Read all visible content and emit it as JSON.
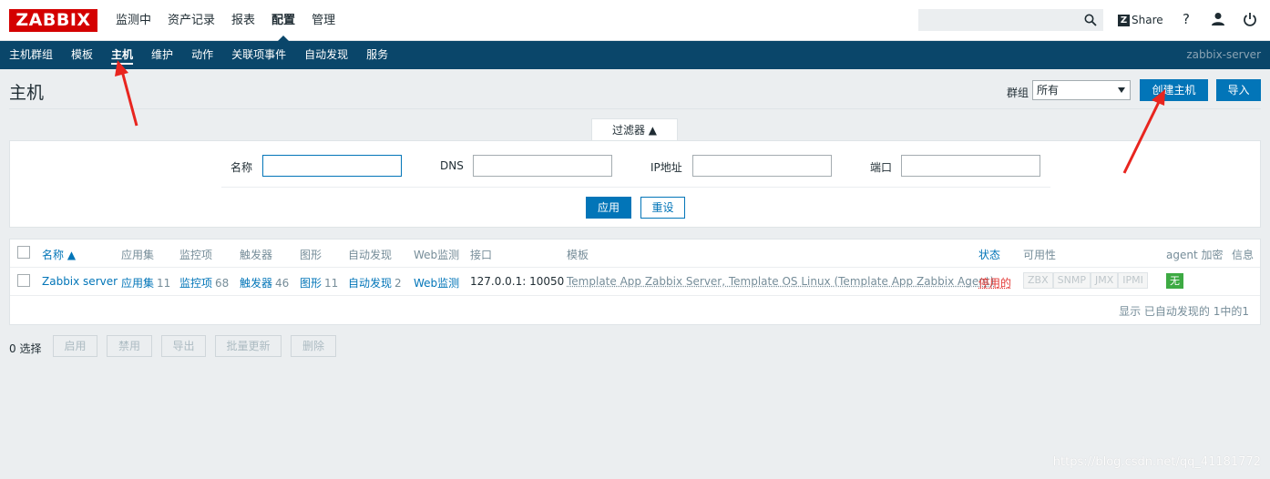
{
  "logo": "ZABBIX",
  "main_nav": [
    {
      "label": "监测中",
      "active": false
    },
    {
      "label": "资产记录",
      "active": false
    },
    {
      "label": "报表",
      "active": false
    },
    {
      "label": "配置",
      "active": true
    },
    {
      "label": "管理",
      "active": false
    }
  ],
  "search": {
    "value": "",
    "placeholder": ""
  },
  "share_label": "Share",
  "help_icon": "?",
  "sub_nav": [
    {
      "label": "主机群组",
      "active": false
    },
    {
      "label": "模板",
      "active": false
    },
    {
      "label": "主机",
      "active": true
    },
    {
      "label": "维护",
      "active": false
    },
    {
      "label": "动作",
      "active": false
    },
    {
      "label": "关联项事件",
      "active": false
    },
    {
      "label": "自动发现",
      "active": false
    },
    {
      "label": "服务",
      "active": false
    }
  ],
  "server_name": "zabbix-server",
  "page_title": "主机",
  "group_label": "群组",
  "group_selected": "所有",
  "create_host_label": "创建主机",
  "import_label": "导入",
  "filter": {
    "tab_label": "过滤器 ▲",
    "name_label": "名称",
    "name_value": "",
    "dns_label": "DNS",
    "dns_value": "",
    "ip_label": "IP地址",
    "ip_value": "",
    "port_label": "端口",
    "port_value": "",
    "apply_label": "应用",
    "reset_label": "重设"
  },
  "table": {
    "headers": {
      "name": "名称 ▲",
      "applications": "应用集",
      "items": "监控项",
      "triggers": "触发器",
      "graphs": "图形",
      "discovery": "自动发现",
      "web": "Web监测",
      "interface": "接口",
      "templates": "模板",
      "status": "状态",
      "availability": "可用性",
      "encryption": "agent 加密",
      "info": "信息"
    },
    "row": {
      "name": "Zabbix server",
      "applications": "应用集",
      "applications_count": "11",
      "items": "监控项",
      "items_count": "68",
      "triggers": "触发器",
      "triggers_count": "46",
      "graphs": "图形",
      "graphs_count": "11",
      "discovery": "自动发现",
      "discovery_count": "2",
      "web": "Web监测",
      "interface": "127.0.0.1: 10050",
      "templates": "Template App Zabbix Server, Template OS Linux (Template App Zabbix Agent)",
      "status": "停用的",
      "availability": [
        "ZBX",
        "SNMP",
        "JMX",
        "IPMI"
      ],
      "encryption": "无"
    },
    "footer": "显示 已自动发现的 1中的1"
  },
  "actions": {
    "selected": "0 选择",
    "enable": "启用",
    "disable": "禁用",
    "export": "导出",
    "mass_update": "批量更新",
    "delete": "删除"
  },
  "watermark": "https://blog.csdn.net/qq_41181772",
  "colors": {
    "brand": "#d40000",
    "subnav_bg": "#0a466a",
    "primary": "#0275b8",
    "status_disabled": "#e33734",
    "encryption_none": "#3daa43",
    "annotation_arrow": "#e8251f"
  }
}
